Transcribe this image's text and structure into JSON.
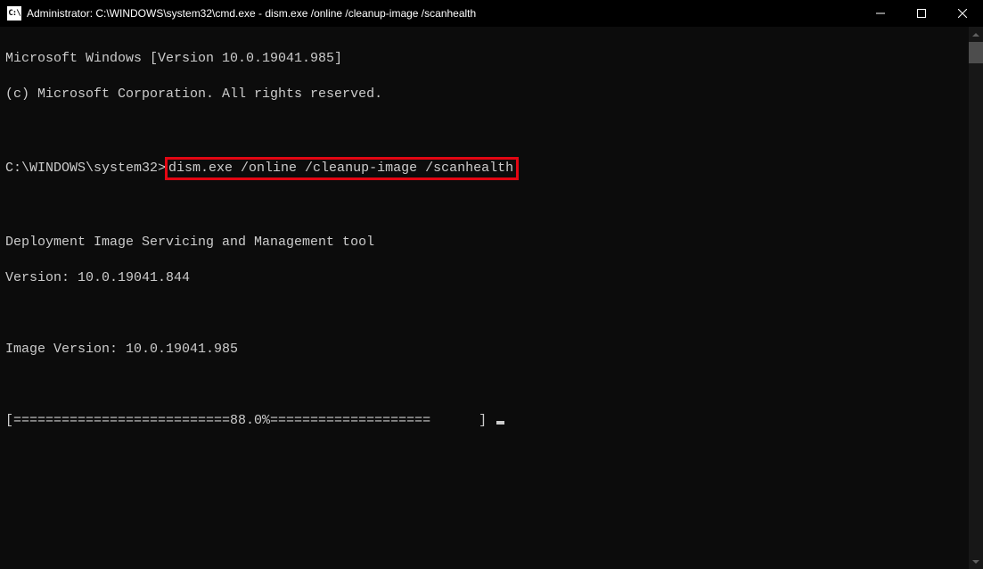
{
  "window": {
    "title": "Administrator: C:\\WINDOWS\\system32\\cmd.exe - dism.exe  /online /cleanup-image /scanhealth"
  },
  "terminal": {
    "line1": "Microsoft Windows [Version 10.0.19041.985]",
    "line2": "(c) Microsoft Corporation. All rights reserved.",
    "prompt": "C:\\WINDOWS\\system32>",
    "command": "dism.exe /online /cleanup-image /scanhealth",
    "tool_line1": "Deployment Image Servicing and Management tool",
    "tool_line2": "Version: 10.0.19041.844",
    "image_version": "Image Version: 10.0.19041.985",
    "progress": "[===========================88.0%====================      ] "
  }
}
